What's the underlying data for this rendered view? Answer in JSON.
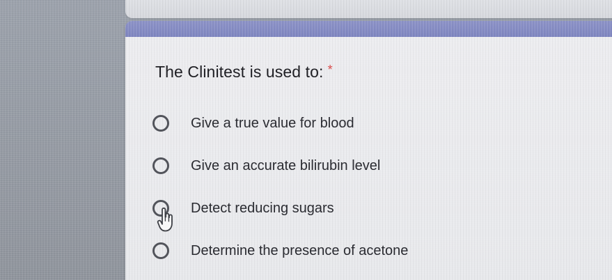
{
  "question": {
    "title": "The Clinitest is used to:",
    "required_mark": "*",
    "options": [
      {
        "label": "Give a true value for blood"
      },
      {
        "label": "Give an accurate bilirubin level"
      },
      {
        "label": "Detect reducing sugars"
      },
      {
        "label": "Determine the presence of acetone"
      }
    ]
  },
  "colors": {
    "accent": "#7f86c1",
    "required": "#d94b4b",
    "text": "#2a2b31",
    "radio": "#52545b"
  },
  "icons": {
    "pointer": "hand-pointer-icon",
    "radio": "radio-button-icon"
  }
}
